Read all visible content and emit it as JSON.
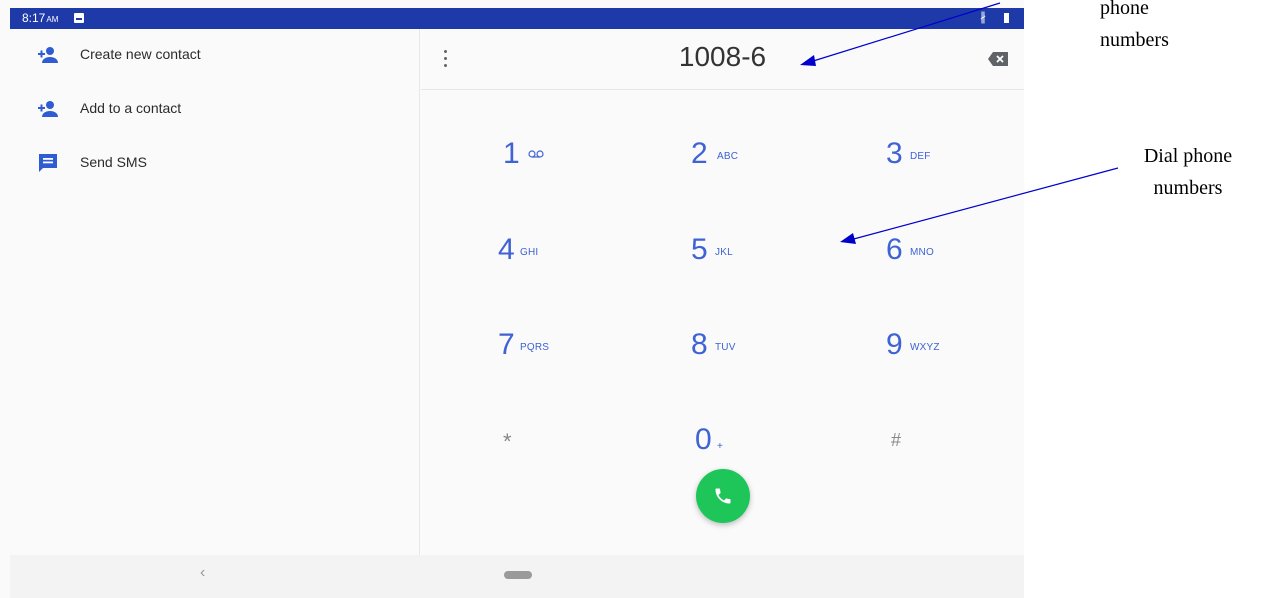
{
  "status_bar": {
    "time": "8:17",
    "ampm": "AM"
  },
  "left_panel": {
    "items": [
      {
        "label": "Create new contact",
        "icon": "person-add-icon"
      },
      {
        "label": "Add to a contact",
        "icon": "person-add-icon"
      },
      {
        "label": "Send SMS",
        "icon": "message-icon"
      }
    ]
  },
  "dialer": {
    "digits": "1008-6",
    "keys": [
      {
        "digit": "1",
        "letters": "voicemail-icon"
      },
      {
        "digit": "2",
        "letters": "ABC"
      },
      {
        "digit": "3",
        "letters": "DEF"
      },
      {
        "digit": "4",
        "letters": "GHI"
      },
      {
        "digit": "5",
        "letters": "JKL"
      },
      {
        "digit": "6",
        "letters": "MNO"
      },
      {
        "digit": "7",
        "letters": "PQRS"
      },
      {
        "digit": "8",
        "letters": "TUV"
      },
      {
        "digit": "9",
        "letters": "WXYZ"
      },
      {
        "digit": "*",
        "letters": ""
      },
      {
        "digit": "0",
        "letters": "+"
      },
      {
        "digit": "#",
        "letters": ""
      }
    ]
  },
  "nav_bar": {
    "back": "‹"
  },
  "annotations": {
    "top": "phone\nnumbers",
    "dial": "Dial phone\nnumbers"
  },
  "colors": {
    "status_bar": "#1e3aa8",
    "accent": "#3f62d4",
    "call": "#1ec65a",
    "annotation_arrow": "#0000cc"
  }
}
